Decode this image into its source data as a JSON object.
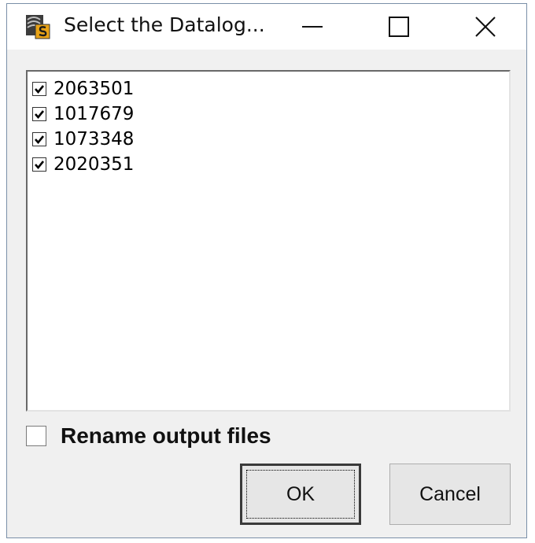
{
  "window": {
    "title": "Select the Datalog..."
  },
  "datalogs": [
    {
      "label": "2063501",
      "checked": true
    },
    {
      "label": "1017679",
      "checked": true
    },
    {
      "label": "1073348",
      "checked": true
    },
    {
      "label": "2020351",
      "checked": true
    }
  ],
  "rename": {
    "label": "Rename output files",
    "checked": false
  },
  "buttons": {
    "ok_label": "OK",
    "cancel_label": "Cancel"
  },
  "icons": {
    "app": "datalog-app-icon",
    "minimize": "minimize-icon",
    "maximize": "maximize-icon",
    "close": "close-icon",
    "check": "checkmark-icon"
  },
  "colors": {
    "titlebar": "#ffffff",
    "client": "#f0f0f0",
    "icon_accent": "#e8a317"
  }
}
